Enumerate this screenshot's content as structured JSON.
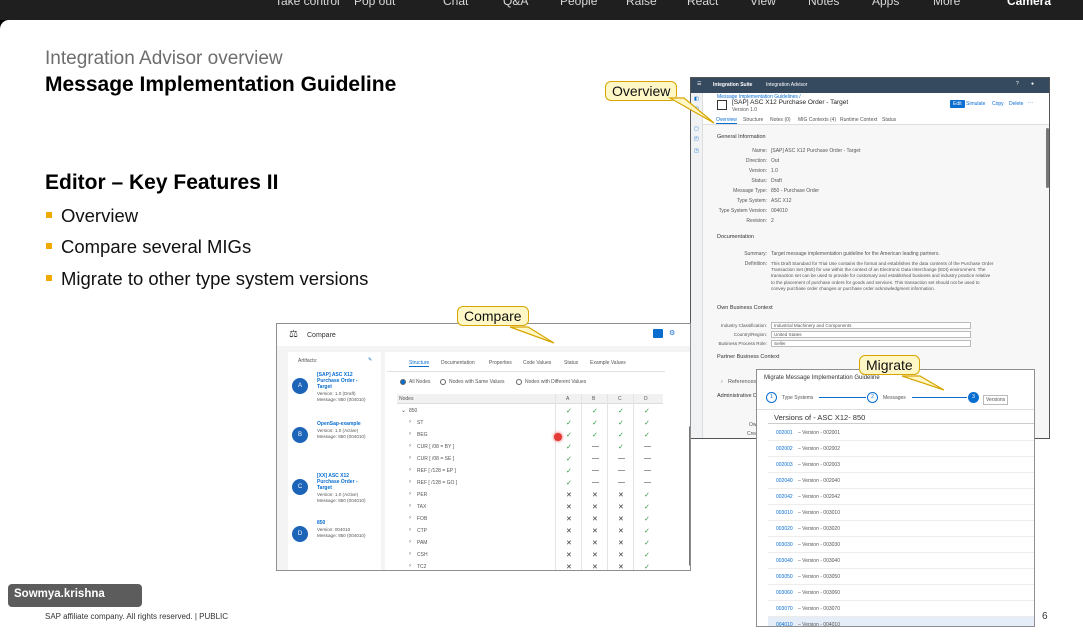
{
  "topbar": [
    "Take control",
    "Pop out",
    "Chat",
    "Q&A",
    "People",
    "Raise",
    "React",
    "View",
    "Notes",
    "Apps",
    "More",
    "Camera"
  ],
  "slide": {
    "subtitle": "Integration Advisor overview",
    "title": "Message Implementation Guideline",
    "section": "Editor – Key Features II",
    "bullets": [
      "Overview",
      "Compare several MIGs",
      "Migrate to other type system versions"
    ],
    "footer": "SAP affiliate company. All rights reserved.  |  PUBLIC",
    "page": "6"
  },
  "presenter": "Sowmya.krishna",
  "callouts": {
    "overview": "Overview",
    "compare": "Compare",
    "migrate": "Migrate"
  },
  "overview": {
    "header": [
      "Integration Suite",
      "Integration Advisor"
    ],
    "breadcrumb": "Message Implementation Guidelines /",
    "doc_title": "[SAP] ASC X12 Purchase Order - Target",
    "version": "Version 1.0",
    "actions": [
      "Edit",
      "Simulate",
      "Copy",
      "Delete",
      "···"
    ],
    "tabs": [
      "Overview",
      "Structure",
      "Notes (0)",
      "MIG Contexts (4)",
      "Runtime Context",
      "Status"
    ],
    "general_title": "General Information",
    "general": [
      [
        "Name:",
        "[SAP] ASC X12 Purchase Order - Target"
      ],
      [
        "Direction:",
        "Out"
      ],
      [
        "Version:",
        "1.0"
      ],
      [
        "Status:",
        "Draft"
      ],
      [
        "Message Type:",
        "850 - Purchase Order"
      ],
      [
        "Type System:",
        "ASC X12"
      ],
      [
        "Type System Version:",
        "004010"
      ],
      [
        "Revision:",
        "2"
      ]
    ],
    "doc_section": "Documentation",
    "summary_label": "Summary:",
    "summary": "Target message implementation guideline for the American leading partners.",
    "definition_label": "Definition:",
    "definition": [
      "This Draft Standard for Trial Use contains the format and establishes the data contents of the Purchase Order",
      "Transaction Set (850) for use within the context of an Electronic Data Interchange (EDI) environment. The",
      "transaction set can be used to provide for customary and established business and industry practice relative",
      "to the placement of purchase orders for goods and services. This transaction set should not be used to",
      "convey purchase order changes or purchase order acknowledgment information."
    ],
    "own_ctx": "Own Business Context",
    "own": [
      [
        "Industry Classification:",
        "Industrial Machinery and Components"
      ],
      [
        "Country/Region:",
        "United States"
      ],
      [
        "Business Process Role:",
        "Seller"
      ]
    ],
    "partner_ctx": "Partner Business Context",
    "references": "References",
    "admin": "Administrative D",
    "admin_rows": [
      "Owne",
      "Create"
    ]
  },
  "compare": {
    "title": "Compare",
    "artifacts_label": "Artifacts:",
    "artifacts": [
      {
        "letter": "A",
        "name": [
          "[SAP] ASC X12",
          "Purchase Order -",
          "Target"
        ],
        "meta": [
          "Version: 1.0 (Draft)",
          "Message: 850 (004010)"
        ]
      },
      {
        "letter": "B",
        "name": [
          "OpenSap-example"
        ],
        "meta": [
          "Version: 1.0 (Active)",
          "Message: 850 (004010)"
        ]
      },
      {
        "letter": "C",
        "name": [
          "[XX] ASC X12",
          "Purchase Order -",
          "Target"
        ],
        "meta": [
          "Version: 1.0 (Active)",
          "Message: 850 (004010)"
        ]
      },
      {
        "letter": "D",
        "name": [
          "850"
        ],
        "meta": [
          "Version: 004010",
          "Message: 850 (004010)"
        ]
      }
    ],
    "tabs": [
      "Structure",
      "Documentation",
      "Properties",
      "Code Values",
      "Status",
      "Example Values"
    ],
    "radios": [
      "All Nodes",
      "Nodes with Same Values",
      "Nodes with Different Values"
    ],
    "col_nodes": "Nodes",
    "cols": [
      "A",
      "B",
      "C",
      "D"
    ],
    "rows": [
      {
        "n": "850",
        "c": [
          "✓",
          "✓",
          "✓",
          "✓"
        ]
      },
      {
        "n": "ST",
        "c": [
          "✓",
          "✓",
          "✓",
          "✓"
        ]
      },
      {
        "n": "BEG",
        "c": [
          "✓",
          "✓",
          "✓",
          "✓"
        ]
      },
      {
        "n": "CUR [ /08 = BY ]",
        "c": [
          "✓",
          "—",
          "✓",
          "—"
        ]
      },
      {
        "n": "CUR [ /08 = SE ]",
        "c": [
          "✓",
          "—",
          "—",
          "—"
        ]
      },
      {
        "n": "REF [ /128 = EP ]",
        "c": [
          "✓",
          "—",
          "—",
          "—"
        ]
      },
      {
        "n": "REF [ /128 = GO ]",
        "c": [
          "✓",
          "—",
          "—",
          "—"
        ]
      },
      {
        "n": "PER",
        "c": [
          "✕",
          "✕",
          "✕",
          "✓"
        ]
      },
      {
        "n": "TAX",
        "c": [
          "✕",
          "✕",
          "✕",
          "✓"
        ]
      },
      {
        "n": "FOB",
        "c": [
          "✕",
          "✕",
          "✕",
          "✓"
        ]
      },
      {
        "n": "CTP",
        "c": [
          "✕",
          "✕",
          "✕",
          "✓"
        ]
      },
      {
        "n": "PAM",
        "c": [
          "✕",
          "✕",
          "✕",
          "✓"
        ]
      },
      {
        "n": "CSH",
        "c": [
          "✕",
          "✕",
          "✕",
          "✓"
        ]
      },
      {
        "n": "TC2",
        "c": [
          "✕",
          "✕",
          "✕",
          "✓"
        ]
      }
    ]
  },
  "migrate": {
    "title": "Migrate Message Implementation Guideline",
    "steps": [
      "Type Systems",
      "Messages",
      "Versions"
    ],
    "versions_title": "Versions of - ASC X12- 850",
    "versions": [
      [
        "002001",
        "Version - 002001"
      ],
      [
        "002002",
        "Version - 002002"
      ],
      [
        "002003",
        "Version - 002003"
      ],
      [
        "002040",
        "Version - 002040"
      ],
      [
        "002042",
        "Version - 002042"
      ],
      [
        "003010",
        "Version - 003010"
      ],
      [
        "003020",
        "Version - 003020"
      ],
      [
        "003030",
        "Version - 003030"
      ],
      [
        "003040",
        "Version - 003040"
      ],
      [
        "003050",
        "Version - 003050"
      ],
      [
        "003060",
        "Version - 003060"
      ],
      [
        "003070",
        "Version - 003070"
      ],
      [
        "004010",
        "Version - 004010"
      ]
    ]
  },
  "colors": {
    "accent": "#0a6ed1",
    "bullet": "#f0ab00",
    "check": "#2b9a3e",
    "callout_bg": "#fff8c6",
    "callout_border": "#d7a500"
  }
}
